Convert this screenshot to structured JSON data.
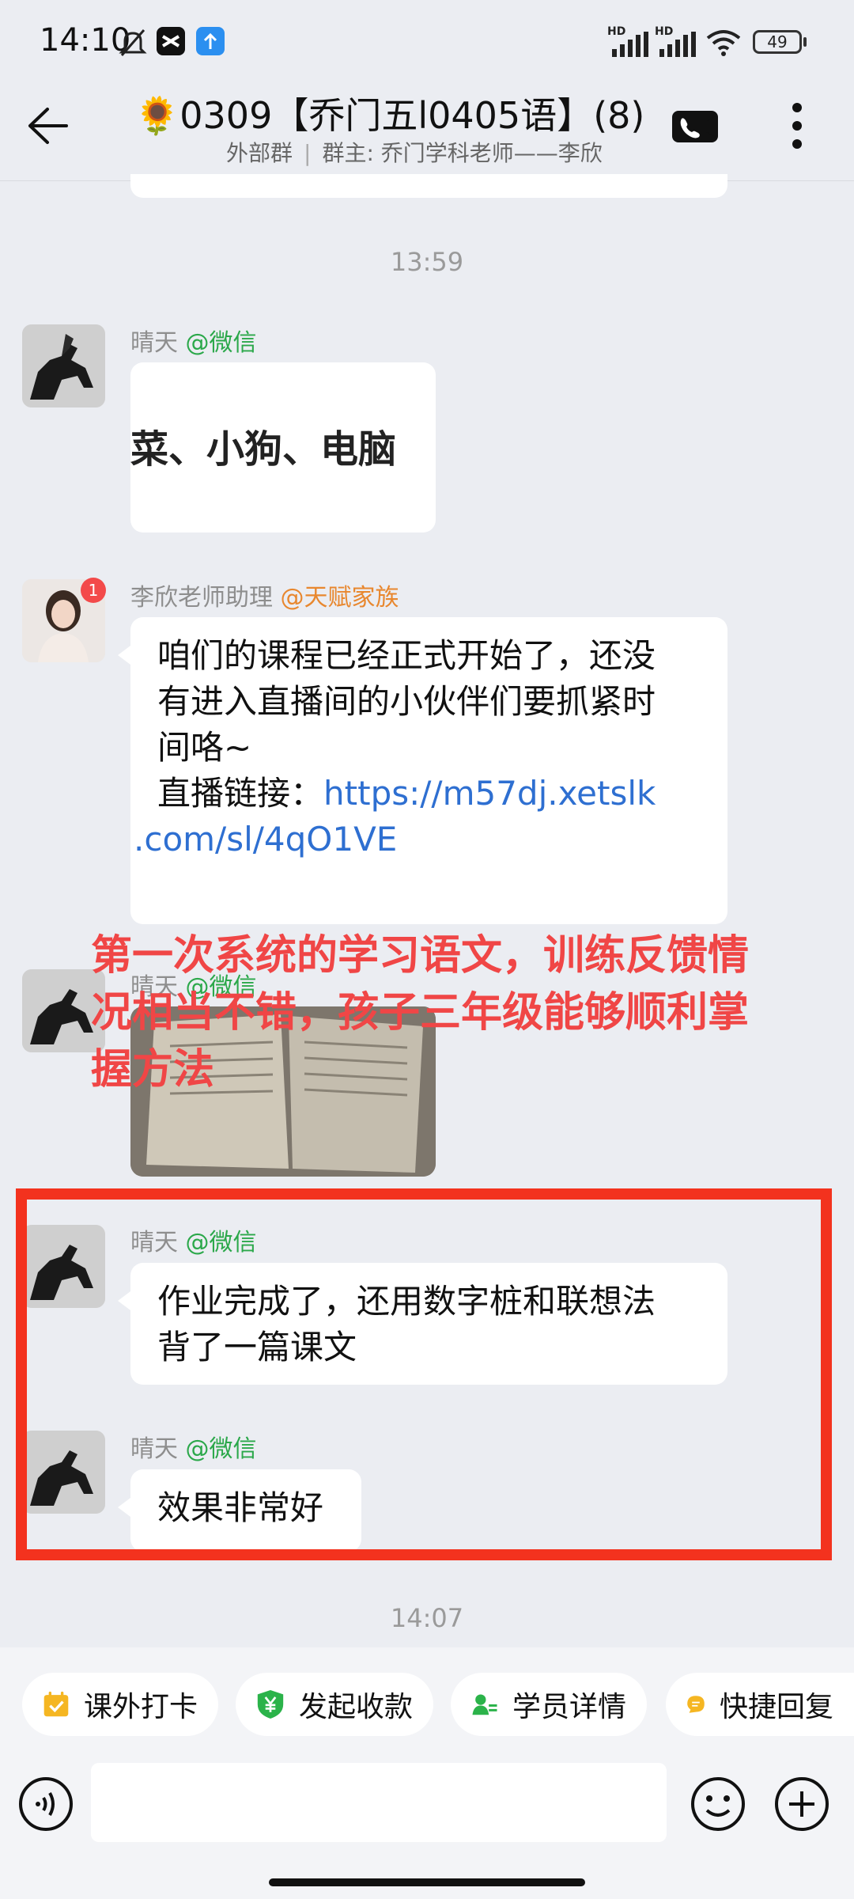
{
  "status_bar": {
    "time": "14:10",
    "signal_1_label": "HD",
    "signal_2_label": "HD",
    "battery": "49",
    "icons": [
      "mute-bell-icon",
      "capcut-icon",
      "upload-arrow-icon",
      "signal-icon",
      "wifi-icon",
      "battery-icon"
    ]
  },
  "header": {
    "title": "🌻0309【乔门五l0405语】(8)",
    "subtitle_left": "外部群",
    "subtitle_right": "群主: 乔门学科老师——李欣",
    "icons": [
      "back-arrow-icon",
      "video-call-icon",
      "more-vertical-icon"
    ]
  },
  "chat": {
    "time_1": "13:59",
    "messages": [
      {
        "sender": "晴天",
        "tag": "@微信",
        "type": "image",
        "image_text": "菜、小狗、电脑"
      },
      {
        "sender": "李欣老师助理",
        "tag": "@天赋家族",
        "badge": "1",
        "type": "text",
        "lines": [
          "咱们的课程已经正式开始了，还没",
          "有进入直播间的小伙伴们要抓紧时",
          "间咯~"
        ],
        "link_label": "直播链接：",
        "link_1": "https://m57dj.xetslk",
        "link_2": ".com/sl/4qO1VE"
      },
      {
        "sender": "晴天",
        "tag": "@微信",
        "type": "image"
      },
      {
        "sender": "晴天",
        "tag": "@微信",
        "type": "text",
        "lines": [
          "作业完成了，还用数字桩和联想法",
          "背了一篇课文"
        ]
      },
      {
        "sender": "晴天",
        "tag": "@微信",
        "type": "text",
        "lines": [
          "效果非常好"
        ]
      }
    ],
    "overlay_caption": [
      "第一次系统的学习语文，训练反馈情",
      "况相当不错，孩子三年级能够顺利掌",
      "握方法"
    ],
    "time_2": "14:07"
  },
  "quick_actions": [
    {
      "label": "课外打卡",
      "icon": "calendar-check-icon",
      "color": "#f5b622"
    },
    {
      "label": "发起收款",
      "icon": "yuan-shield-icon",
      "color": "#2bb34a"
    },
    {
      "label": "学员详情",
      "icon": "user-card-icon",
      "color": "#2bb34a"
    },
    {
      "label": "快捷回复",
      "icon": "quick-reply-icon",
      "color": "#f5b622"
    }
  ],
  "input_bar": {
    "icons": [
      "voice-icon",
      "emoji-icon",
      "plus-icon"
    ]
  },
  "colors": {
    "background": "#ebedf2",
    "highlight_box": "#f3321e",
    "overlay_text": "#f04646",
    "link": "#2e6fd1",
    "tag_green": "#2ba84a",
    "tag_orange": "#e8872e"
  }
}
